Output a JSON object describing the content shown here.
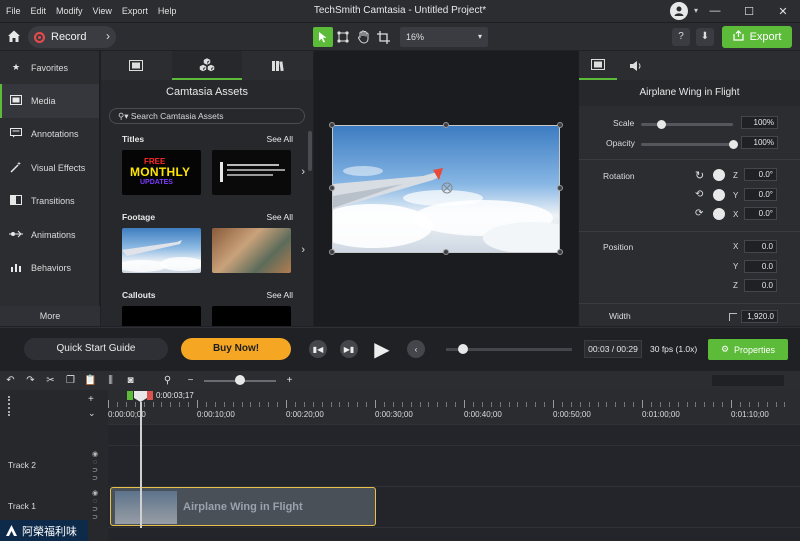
{
  "titlebar": {
    "menu": [
      "File",
      "Edit",
      "Modify",
      "View",
      "Export",
      "Help"
    ],
    "title": "TechSmith Camtasia - Untitled Project*"
  },
  "toolbar": {
    "record_label": "Record",
    "zoom_value": "16%",
    "help_label": "?",
    "export_label": "Export",
    "accent_color": "#5dbb3a"
  },
  "leftnav": {
    "items": [
      {
        "label": "Favorites",
        "icon": "star-icon"
      },
      {
        "label": "Media",
        "icon": "film-icon"
      },
      {
        "label": "Annotations",
        "icon": "annotation-icon"
      },
      {
        "label": "Visual Effects",
        "icon": "magic-wand-icon"
      },
      {
        "label": "Transitions",
        "icon": "transition-icon"
      },
      {
        "label": "Animations",
        "icon": "animation-icon"
      },
      {
        "label": "Behaviors",
        "icon": "behavior-icon"
      }
    ],
    "more_label": "More",
    "active": "Media"
  },
  "assets": {
    "heading": "Camtasia Assets",
    "search_placeholder": "Search Camtasia Assets",
    "sections": [
      {
        "title": "Titles",
        "see_all": "See All"
      },
      {
        "title": "Footage",
        "see_all": "See All"
      },
      {
        "title": "Callouts",
        "see_all": "See All"
      }
    ],
    "title_thumb_text": [
      "FREE",
      "MONTHLY",
      "UPDATES"
    ]
  },
  "properties": {
    "clip_title": "Airplane Wing in Flight",
    "scale_label": "Scale",
    "scale_value": "100%",
    "opacity_label": "Opacity",
    "opacity_value": "100%",
    "rotation_label": "Rotation",
    "rotation": {
      "z": "0.0°",
      "y": "0.0°",
      "x": "0.0°"
    },
    "position_label": "Position",
    "position": {
      "x": "0.0",
      "y": "0.0",
      "z": "0.0"
    },
    "width_label": "Width",
    "width_value": "1,920.0",
    "axis_labels": [
      "Z",
      "Y",
      "X",
      "X",
      "Y",
      "Z"
    ]
  },
  "playback": {
    "quick_start": "Quick Start Guide",
    "buy_now": "Buy Now!",
    "current_time": "00:03 / 00:29",
    "fps": "30 fps (1.0x)",
    "properties_label": "Properties",
    "buy_color": "#f5a623"
  },
  "timeline": {
    "playhead_time": "0:00:03;17",
    "ruler_labels": [
      "0:00:00;00",
      "0:00:10;00",
      "0:00:20;00",
      "0:00:30;00",
      "0:00:40;00",
      "0:00:50;00",
      "0:01:00;00",
      "0:01:10;00"
    ],
    "tracks": [
      {
        "name": "Track 2"
      },
      {
        "name": "Track 1"
      }
    ],
    "clip_label": "Airplane Wing in Flight",
    "clip_border_color": "#e8c14a"
  },
  "watermark": {
    "text": "阿榮福利味"
  }
}
